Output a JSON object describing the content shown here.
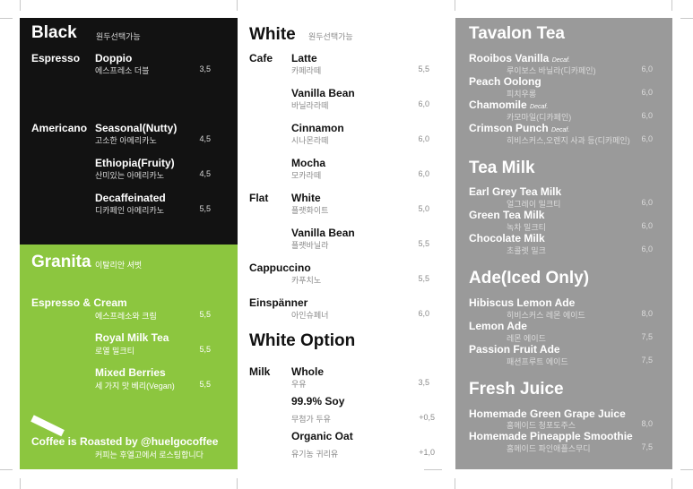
{
  "black": {
    "title": "Black",
    "subtitle": "원두선택가능",
    "items": [
      {
        "category": "Espresso",
        "name": "Doppio",
        "kor": "에스프레소 더블",
        "price": "3,5"
      },
      {
        "category": "Americano",
        "name": "Seasonal(Nutty)",
        "kor": "고소한 아메리카노",
        "price": "4,5"
      },
      {
        "category": "",
        "name": "Ethiopia(Fruity)",
        "kor": "산미있는 아메리카노",
        "price": "4,5"
      },
      {
        "category": "",
        "name": "Decaffeinated",
        "kor": "디카페인 아메리카노",
        "price": "5,5"
      }
    ]
  },
  "granita": {
    "title": "Granita",
    "subtitle": "이탈리안 셔벗",
    "items": [
      {
        "name": "Espresso & Cream",
        "kor": "에스프레소와 크림",
        "price": "5,5"
      },
      {
        "name": "Royal Milk Tea",
        "kor": "로열 밀크티",
        "price": "5,5"
      },
      {
        "name": "Mixed Berries",
        "kor": "세 가지 맛 베리(Vegan)",
        "price": "5,5"
      }
    ],
    "footer": "Coffee is Roasted by @huelgocoffee",
    "footer_kor": "커피는 후엘고에서 로스팅합니다"
  },
  "white": {
    "title": "White",
    "subtitle": "원두선택가능",
    "items": [
      {
        "category": "Cafe",
        "name": "Latte",
        "kor": "카페라떼",
        "price": "5,5"
      },
      {
        "category": "",
        "name": "Vanilla Bean",
        "kor": "바닐라라떼",
        "price": "6,0"
      },
      {
        "category": "",
        "name": "Cinnamon",
        "kor": "시나몬라떼",
        "price": "6,0"
      },
      {
        "category": "",
        "name": "Mocha",
        "kor": "모카라떼",
        "price": "6,0"
      },
      {
        "category": "Flat",
        "name": "White",
        "kor": "플랫화이트",
        "price": "5,0"
      },
      {
        "category": "",
        "name": "Vanilla Bean",
        "kor": "플랫바닐라",
        "price": "5,5"
      },
      {
        "category": "",
        "name": "Cappuccino",
        "kor": "카푸치노",
        "price": "5,5"
      },
      {
        "category": "",
        "name": "Einspänner",
        "kor": "아인슈페너",
        "price": "6,0"
      }
    ],
    "option_title": "White Option",
    "options": [
      {
        "category": "Milk",
        "name": "Whole",
        "kor": "우유",
        "price": "3,5"
      },
      {
        "category": "",
        "name": "99.9% Soy",
        "kor": "무첨가 두유",
        "price": "+0,5"
      },
      {
        "category": "",
        "name": "Organic Oat",
        "kor": "유기농 귀리유",
        "price": "+1,0"
      }
    ]
  },
  "tea": {
    "title": "Tavalon Tea",
    "items": [
      {
        "name": "Rooibos Vanilla",
        "decaf": "Decaf.",
        "kor": "루이보스 바닐라(디카페인)",
        "price": "6,0"
      },
      {
        "name": "Peach Oolong",
        "decaf": "",
        "kor": "피치우롱",
        "price": "6,0"
      },
      {
        "name": "Chamomile",
        "decaf": "Decaf.",
        "kor": "카모마일(디카페인)",
        "price": "6,0"
      },
      {
        "name": "Crimson Punch",
        "decaf": "Decaf.",
        "kor": "히비스커스,오렌지 사과 등(디카페인)",
        "price": "6,0"
      }
    ]
  },
  "tea_milk": {
    "title": "Tea Milk",
    "items": [
      {
        "name": "Earl Grey Tea Milk",
        "kor": "얼그레이 밀크티",
        "price": "6,0"
      },
      {
        "name": "Green Tea Milk",
        "kor": "녹차 밀크티",
        "price": "6,0"
      },
      {
        "name": "Chocolate Milk",
        "kor": "초콜렛 밀크",
        "price": "6,0"
      }
    ]
  },
  "ade": {
    "title": "Ade(Iced Only)",
    "items": [
      {
        "name": "Hibiscus Lemon Ade",
        "kor": "히비스커스 레몬 에이드",
        "price": "8,0"
      },
      {
        "name": "Lemon Ade",
        "kor": "레몬 에이드",
        "price": "7,5"
      },
      {
        "name": "Passion Fruit Ade",
        "kor": "패션프루트 에이드",
        "price": "7,5"
      }
    ]
  },
  "juice": {
    "title": "Fresh Juice",
    "items": [
      {
        "name": "Homemade Green Grape Juice",
        "kor": "홈메이드 청포도주스",
        "price": "8,0"
      },
      {
        "name": "Homemade Pineapple Smoothie",
        "kor": "홈메이드 파인애플스무디",
        "price": "7,5"
      }
    ]
  }
}
